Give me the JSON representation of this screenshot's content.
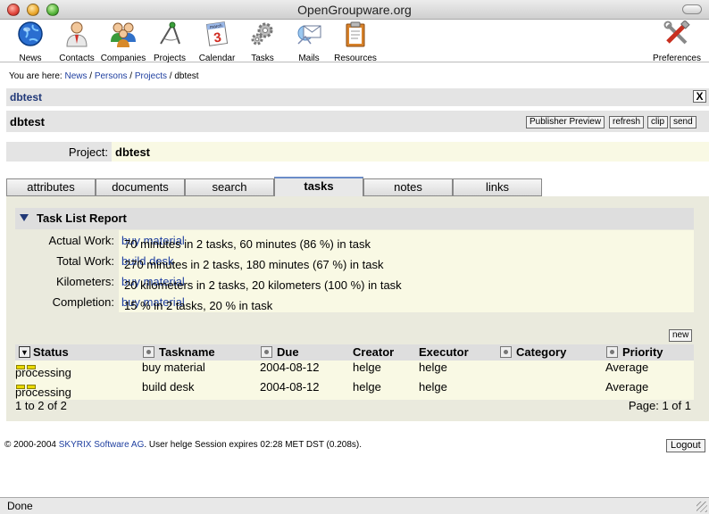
{
  "window": {
    "title": "OpenGroupware.org"
  },
  "toolbar": {
    "items": [
      {
        "label": "News",
        "icon": "globe-icon"
      },
      {
        "label": "Contacts",
        "icon": "person-icon"
      },
      {
        "label": "Companies",
        "icon": "group-icon"
      },
      {
        "label": "Projects",
        "icon": "compass-icon"
      },
      {
        "label": "Calendar",
        "icon": "calendar-icon"
      },
      {
        "label": "Tasks",
        "icon": "gears-icon"
      },
      {
        "label": "Mails",
        "icon": "mail-icon"
      },
      {
        "label": "Resources",
        "icon": "clipboard-icon"
      },
      {
        "label": "Preferences",
        "icon": "tools-icon"
      }
    ],
    "calendar_month": "march",
    "calendar_day": "3"
  },
  "breadcrumb": {
    "prefix": "You are here:",
    "links": [
      "News",
      "Persons",
      "Projects"
    ],
    "separator": "/",
    "current": "dbtest"
  },
  "nav_title": "dbtest",
  "close_label": "X",
  "header": {
    "title": "dbtest",
    "buttons": [
      "Publisher Preview",
      "refresh",
      "clip",
      "send"
    ]
  },
  "project": {
    "label": "Project:",
    "value": "dbtest"
  },
  "tabs": [
    {
      "label": "attributes",
      "active": false
    },
    {
      "label": "documents",
      "active": false
    },
    {
      "label": "search",
      "active": false
    },
    {
      "label": "tasks",
      "active": true
    },
    {
      "label": "notes",
      "active": false
    },
    {
      "label": "links",
      "active": false
    }
  ],
  "report": {
    "title": "Task List Report",
    "rows": [
      {
        "label": "Actual Work:",
        "text": "70 minutes in 2 tasks, 60 minutes (86 %) in task",
        "link": "buy material"
      },
      {
        "label": "Total Work:",
        "text": "270 minutes in 2 tasks, 180 minutes (67 %) in task",
        "link": "build desk"
      },
      {
        "label": "Kilometers:",
        "text": "20 kilometers in 2 tasks, 20 kilometers (100 %) in task",
        "link": "buy material"
      },
      {
        "label": "Completion:",
        "text": "15 % in 2 tasks, 20 % in task",
        "link": "buy material"
      }
    ]
  },
  "task_table": {
    "new_label": "new",
    "columns": [
      "Status",
      "Taskname",
      "Due",
      "Creator",
      "Executor",
      "Category",
      "Priority"
    ],
    "rows": [
      {
        "status": "processing",
        "taskname": "buy material",
        "due": "2004-08-12",
        "creator": "helge",
        "executor": "helge",
        "category": "",
        "priority": "Average"
      },
      {
        "status": "processing",
        "taskname": "build desk",
        "due": "2004-08-12",
        "creator": "helge",
        "executor": "helge",
        "category": "",
        "priority": "Average"
      }
    ],
    "range": "1 to 2 of 2",
    "page": "Page: 1 of 1"
  },
  "footer": {
    "copyright": "© 2000-2004",
    "company": "SKYRIX Software AG",
    "session": ". User helge Session expires 02:28 MET DST (0.208s).",
    "logout_label": "Logout"
  },
  "status_bar": {
    "text": "Done"
  },
  "colors": {
    "link": "#2040a0",
    "row_bg": "#f9f9e4",
    "panel_bg": "#eaeadd",
    "header_bg": "#e4e4e4",
    "status_yellow": "#e8d800"
  }
}
